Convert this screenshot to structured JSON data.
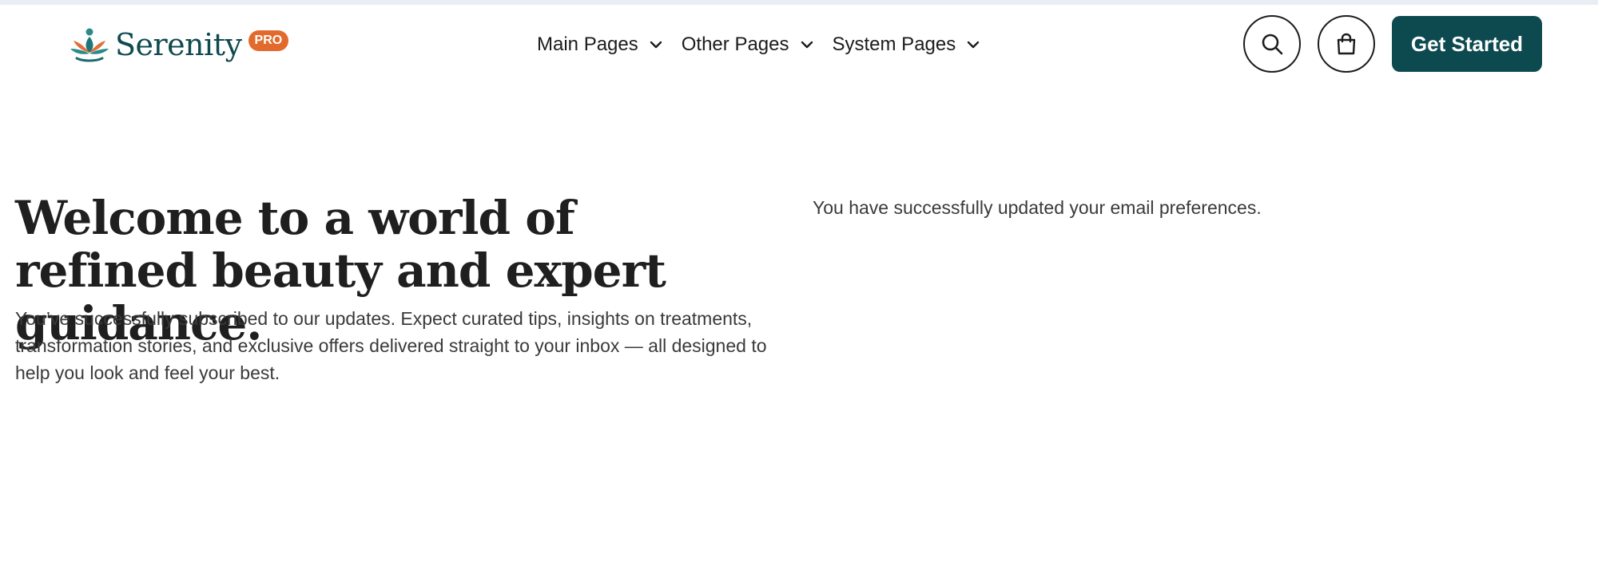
{
  "brand": {
    "name": "Serenity",
    "badge": "PRO",
    "logo_icon": "lotus-meditation-logo"
  },
  "nav": {
    "items": [
      {
        "label": "Main Pages",
        "icon": "chevron-down-icon"
      },
      {
        "label": "Other Pages",
        "icon": "chevron-down-icon"
      },
      {
        "label": "System Pages",
        "icon": "chevron-down-icon"
      }
    ]
  },
  "actions": {
    "search_icon": "search-icon",
    "bag_icon": "shopping-bag-icon",
    "cta_label": "Get Started"
  },
  "hero": {
    "title": "Welcome to a world of refined beauty and expert guidance.",
    "text": "You’ve successfully subscribed to our updates. Expect curated tips, insights on treatments, transformation stories, and exclusive offers delivered straight to your inbox — all designed to help you look and feel your best."
  },
  "status": {
    "message": "You have successfully updated your email preferences."
  },
  "colors": {
    "brand_teal": "#0d4a4f",
    "badge_orange": "#e26a2c",
    "top_strip": "#e9eef5",
    "text_dark": "#1f1f1f",
    "text_body": "#3a3a3a"
  }
}
